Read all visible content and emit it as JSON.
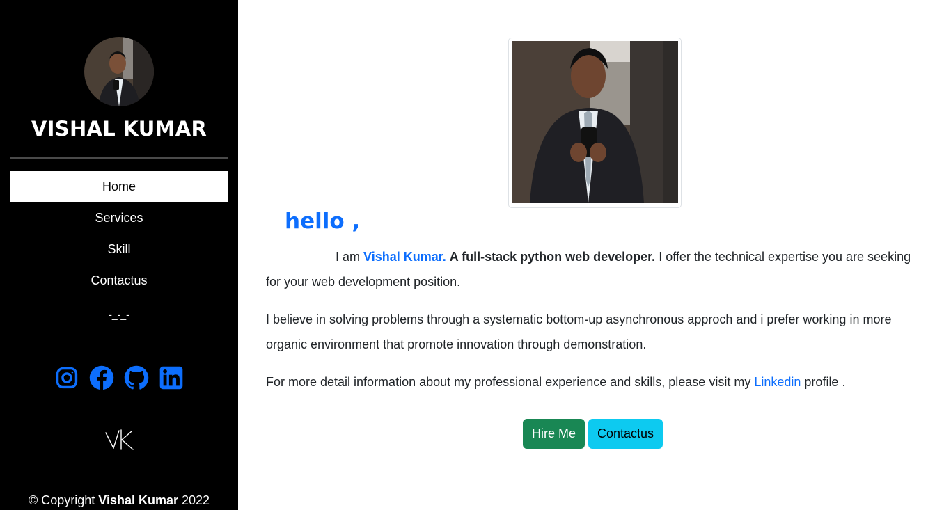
{
  "sidebar": {
    "name": "VISHAL KUMAR",
    "nav": [
      {
        "label": "Home",
        "active": true
      },
      {
        "label": "Services",
        "active": false
      },
      {
        "label": "Skill",
        "active": false
      },
      {
        "label": "Contactus",
        "active": false
      }
    ],
    "extra": "-_-_-",
    "socials": [
      "instagram-icon",
      "facebook-icon",
      "github-icon",
      "linkedin-icon"
    ],
    "social_color": "#0d6efd",
    "copyright_prefix": "© Copyright",
    "copyright_name": "Vishal Kumar",
    "copyright_year": "2022"
  },
  "main": {
    "greeting": "hello ,",
    "intro_lead": "I am",
    "intro_name": "Vishal Kumar.",
    "intro_bold": "A full-stack python web developer.",
    "intro_rest": "I offer the technical expertise you are seeking for your web development position.",
    "paragraph2": "I believe in solving problems through a systematic bottom-up asynchronous approch and i prefer working in more organic environment that promote innovation through demonstration.",
    "p3_lead": "For more detail information about my professional experience and skills, please visit my",
    "p3_link": "Linkedin",
    "p3_tail": "profile .",
    "buttons": {
      "hire": "Hire Me",
      "contact": "Contactus"
    }
  },
  "colors": {
    "accent": "#0d6efd",
    "success": "#198754",
    "info": "#0dcaf0",
    "sidebar_bg": "#000000"
  }
}
